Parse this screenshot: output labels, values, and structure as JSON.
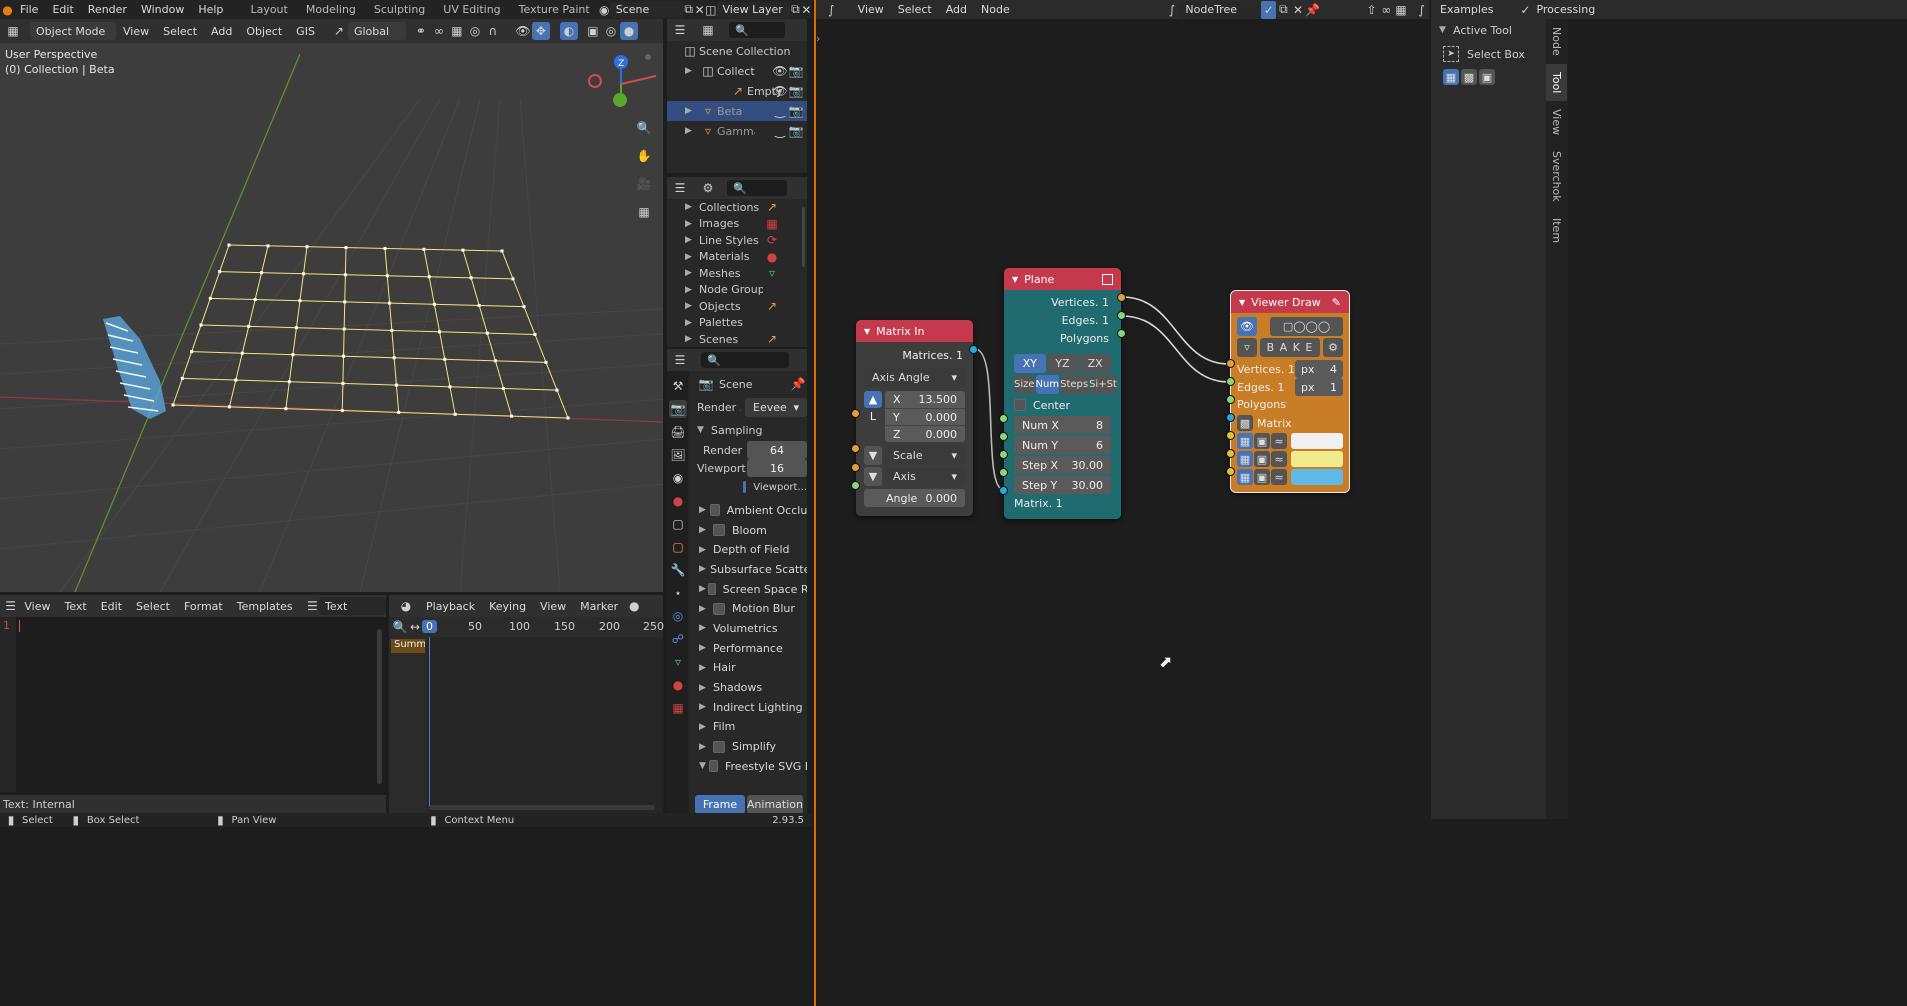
{
  "topbar": {
    "menus": [
      "File",
      "Edit",
      "Render",
      "Window",
      "Help"
    ],
    "workspaces": [
      "Layout",
      "Modeling",
      "Sculpting",
      "UV Editing",
      "Texture Paint"
    ],
    "scene": "Scene",
    "view_layer": "View Layer"
  },
  "viewport": {
    "mode": "Object Mode",
    "menus": [
      "View",
      "Select",
      "Add",
      "Object",
      "GIS"
    ],
    "orientation": "Global",
    "info_line1": "User Perspective",
    "info_line2": "(0) Collection | Beta"
  },
  "text_editor": {
    "menus": [
      "View",
      "Text",
      "Edit",
      "Select",
      "Format",
      "Templates"
    ],
    "name": "Text",
    "line_number": "1",
    "footer": "Text: Internal"
  },
  "timeline": {
    "menus": [
      "Playback",
      "Keying",
      "View",
      "Marker"
    ],
    "current_frame": "0",
    "ticks": [
      "50",
      "100",
      "150",
      "200",
      "250"
    ],
    "summary": "Summary"
  },
  "outliner": {
    "root": "Scene Collection",
    "items": [
      {
        "label": "Collection",
        "indent": 1
      },
      {
        "label": "Empty",
        "indent": 2
      },
      {
        "label": "Beta",
        "indent": 1,
        "selected": true
      },
      {
        "label": "Gamma",
        "indent": 1
      }
    ]
  },
  "datablocks": {
    "items": [
      "Collections",
      "Images",
      "Line Styles",
      "Materials",
      "Meshes",
      "Node Groups",
      "Objects",
      "Palettes",
      "Scenes"
    ]
  },
  "properties": {
    "scene": "Scene",
    "render_engine_label": "Render ...",
    "render_engine": "Eevee",
    "sampling": "Sampling",
    "render_label": "Render",
    "render_value": "64",
    "viewport_label": "Viewport",
    "viewport_value": "16",
    "viewport_denoise": "Viewport...",
    "panels": [
      {
        "label": "Ambient Occlusion",
        "check": true
      },
      {
        "label": "Bloom",
        "check": true
      },
      {
        "label": "Depth of Field",
        "check": false
      },
      {
        "label": "Subsurface Scattering",
        "check": false
      },
      {
        "label": "Screen Space Reflections",
        "check": true
      },
      {
        "label": "Motion Blur",
        "check": true
      },
      {
        "label": "Volumetrics",
        "check": false
      },
      {
        "label": "Performance",
        "check": false
      },
      {
        "label": "Hair",
        "check": false
      },
      {
        "label": "Shadows",
        "check": false
      },
      {
        "label": "Indirect Lighting",
        "check": false
      },
      {
        "label": "Film",
        "check": false
      },
      {
        "label": "Simplify",
        "check": true
      },
      {
        "label": "Freestyle SVG Export",
        "check": true,
        "open": true
      }
    ],
    "tabs": [
      "Frame",
      "Animation"
    ]
  },
  "node_editor": {
    "menus": [
      "View",
      "Select",
      "Add",
      "Node"
    ],
    "tree": "NodeTree",
    "right_menus": [
      "Examples",
      "Processing"
    ]
  },
  "node_matrix_in": {
    "title": "Matrix In",
    "output": "Matrices. 1",
    "mode": "Axis Angle",
    "x_label": "X",
    "x_value": "13.500",
    "y_label": "Y",
    "y_value": "0.000",
    "z_label": "Z",
    "z_value": "0.000",
    "l_label": "L",
    "scale": "Scale",
    "axis": "Axis",
    "angle_label": "Angle",
    "angle_value": "0.000"
  },
  "node_plane": {
    "title": "Plane",
    "outputs": [
      "Vertices. 1",
      "Edges. 1",
      "Polygons"
    ],
    "dir_tabs": [
      "XY",
      "YZ",
      "ZX"
    ],
    "mode_tabs": [
      "Size",
      "Num",
      "Steps",
      "Si+St"
    ],
    "center": "Center",
    "numx_label": "Num X",
    "numx": "8",
    "numy_label": "Num Y",
    "numy": "6",
    "stepx_label": "Step X",
    "stepx": "30.00",
    "stepy_label": "Step Y",
    "stepy": "30.00",
    "input": "Matrix. 1"
  },
  "node_viewer": {
    "title": "Viewer Draw",
    "bake": "B A K E",
    "vertices": "Vertices. 1",
    "vert_px": "px",
    "vert_size": "4",
    "edges": "Edges. 1",
    "edge_px": "px",
    "edge_size": "1",
    "polygons": "Polygons",
    "matrix": "Matrix",
    "colors": {
      "vert": "#f0f0f0",
      "edge": "#f2eb8e",
      "poly": "#5fb8e6"
    }
  },
  "sidebar": {
    "header": "Active Tool",
    "tool": "Select Box",
    "tabs": [
      "Node",
      "Tool",
      "View",
      "Sverchok",
      "Item"
    ]
  },
  "statusbar": {
    "select": "Select",
    "box_select": "Box Select",
    "pan_view": "Pan View",
    "context_menu": "Context Menu",
    "version": "2.93.5"
  },
  "colors": {
    "accent": "#4772b3",
    "node_matrix": "#c43a4c",
    "node_plane": "#1f6b6f",
    "node_viewer": "#c97d26"
  }
}
